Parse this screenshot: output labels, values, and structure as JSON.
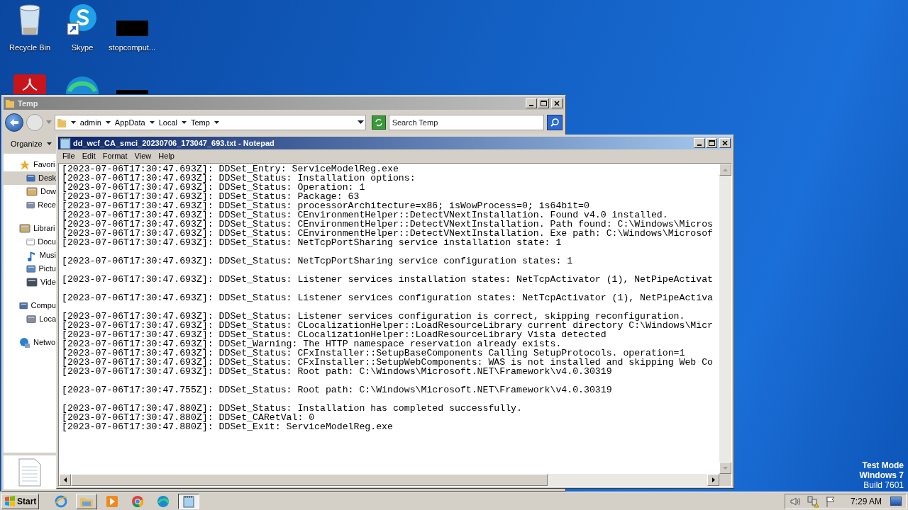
{
  "desktop": {
    "icons": [
      {
        "kind": "recycle-bin",
        "label": "Recycle Bin"
      },
      {
        "kind": "skype",
        "label": "Skype"
      },
      {
        "kind": "black-thumbnail",
        "label": "stopcomput..."
      },
      {
        "kind": "pdf"
      },
      {
        "kind": "edge"
      },
      {
        "kind": "black-thumbnail"
      }
    ],
    "watermark_text": [
      "Test Mode",
      "Windows 7",
      "Build 7601"
    ]
  },
  "explorer": {
    "title": "Temp",
    "breadcrumb": [
      "admin",
      "AppData",
      "Local",
      "Temp"
    ],
    "search": {
      "placeholder": "Search Temp"
    },
    "toolbar": [
      "Organize"
    ],
    "nav": [
      {
        "kind": "favorites",
        "label": "Favori",
        "children": [
          {
            "kind": "desktop",
            "label": "Desk",
            "selected": true
          },
          {
            "kind": "downloads",
            "label": "Dow",
            "selected": false
          },
          {
            "kind": "recent",
            "label": "Rece",
            "selected": false
          }
        ]
      },
      {
        "kind": "libraries",
        "label": "Librari",
        "children": [
          {
            "kind": "documents",
            "label": "Docu",
            "selected": false
          },
          {
            "kind": "music",
            "label": "Musi",
            "selected": false
          },
          {
            "kind": "pictures",
            "label": "Pictu",
            "selected": false
          },
          {
            "kind": "videos",
            "label": "Vide",
            "selected": false
          }
        ]
      },
      {
        "kind": "computer",
        "label": "Compu",
        "children": [
          {
            "kind": "disk",
            "label": "Loca",
            "selected": false
          }
        ]
      },
      {
        "kind": "network",
        "label": "Netwo"
      }
    ]
  },
  "notepad": {
    "title": "dd_wcf_CA_smci_20230706_173047_693.txt - Notepad",
    "menu": [
      "File",
      "Edit",
      "Format",
      "View",
      "Help"
    ],
    "paragraphs": [
      [
        "[2023-07-06T17:30:47.693Z]: DDSet_Entry: ServiceModelReg.exe",
        "[2023-07-06T17:30:47.693Z]: DDSet_Status: Installation options:",
        "[2023-07-06T17:30:47.693Z]: DDSet_Status: Operation: 1",
        "[2023-07-06T17:30:47.693Z]: DDSet_Status: Package: 63",
        "[2023-07-06T17:30:47.693Z]: DDSet_Status: processorArchitecture=x86; isWowProcess=0; is64bit=0",
        "[2023-07-06T17:30:47.693Z]: DDSet_Status: CEnvironmentHelper::DetectVNextInstallation. Found v4.0 installed.",
        "[2023-07-06T17:30:47.693Z]: DDSet_Status: CEnvironmentHelper::DetectVNextInstallation. Path found: C:\\Windows\\Micros",
        "[2023-07-06T17:30:47.693Z]: DDSet_Status: CEnvironmentHelper::DetectVNextInstallation. Exe path: C:\\Windows\\Microsof",
        "[2023-07-06T17:30:47.693Z]: DDSet_Status: NetTcpPortSharing service installation state: 1"
      ],
      [
        "[2023-07-06T17:30:47.693Z]: DDSet_Status: NetTcpPortSharing service configuration states: 1"
      ],
      [
        "[2023-07-06T17:30:47.693Z]: DDSet_Status: Listener services installation states: NetTcpActivator (1), NetPipeActivat"
      ],
      [
        "[2023-07-06T17:30:47.693Z]: DDSet_Status: Listener services configuration states: NetTcpActivator (1), NetPipeActiva"
      ],
      [
        "[2023-07-06T17:30:47.693Z]: DDSet_Status: Listener services configuration is correct, skipping reconfiguration.",
        "[2023-07-06T17:30:47.693Z]: DDSet_Status: CLocalizationHelper::LoadResourceLibrary current directory C:\\Windows\\Micr",
        "[2023-07-06T17:30:47.693Z]: DDSet_Status: CLocalizationHelper::LoadResourceLibrary Vista detected",
        "[2023-07-06T17:30:47.693Z]: DDSet_Warning: The HTTP namespace reservation already exists.",
        "[2023-07-06T17:30:47.693Z]: DDSet_Status: CFxInstaller::SetupBaseComponents Calling SetupProtocols. operation=1",
        "[2023-07-06T17:30:47.693Z]: DDSet_Status: CFxInstaller::SetupWebComponents: WAS is not installed and skipping Web Co",
        "[2023-07-06T17:30:47.693Z]: DDSet_Status: Root path: C:\\Windows\\Microsoft.NET\\Framework\\v4.0.30319"
      ],
      [
        "[2023-07-06T17:30:47.755Z]: DDSet_Status: Root path: C:\\Windows\\Microsoft.NET\\Framework\\v4.0.30319"
      ],
      [
        "[2023-07-06T17:30:47.880Z]: DDSet_Status: Installation has completed successfully.",
        "[2023-07-06T17:30:47.880Z]: DDSet_CARetVal: 0",
        "[2023-07-06T17:30:47.880Z]: DDSet_Exit: ServiceModelReg.exe"
      ]
    ]
  },
  "taskbar": {
    "start": "Start",
    "items": [
      {
        "kind": "ie",
        "open": false,
        "selected": false
      },
      {
        "kind": "explorer",
        "open": true,
        "selected": false
      },
      {
        "kind": "media",
        "open": false,
        "selected": false
      },
      {
        "kind": "chrome",
        "open": false,
        "selected": false
      },
      {
        "kind": "edge",
        "open": false,
        "selected": false
      },
      {
        "kind": "notepad",
        "open": true,
        "selected": true
      }
    ],
    "tray": [
      {
        "kind": "speaker"
      },
      {
        "kind": "network"
      },
      {
        "kind": "flag"
      }
    ],
    "clock": "7:29 AM"
  }
}
